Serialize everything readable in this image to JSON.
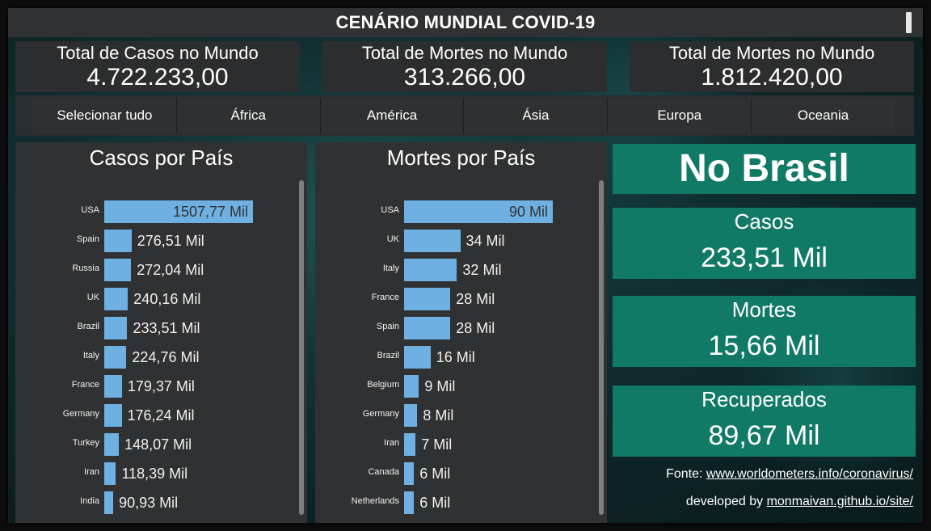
{
  "header": {
    "title": "CENÁRIO MUNDIAL COVID-19"
  },
  "kpis": [
    {
      "label": "Total de Casos no Mundo",
      "value": "4.722.233,00"
    },
    {
      "label": "Total de Mortes no Mundo",
      "value": "313.266,00"
    },
    {
      "label": "Total de Mortes no Mundo",
      "value": "1.812.420,00"
    }
  ],
  "slicer": {
    "items": [
      "Selecionar tudo",
      "África",
      "América",
      "Ásia",
      "Europa",
      "Oceania"
    ]
  },
  "chart_data": [
    {
      "type": "bar",
      "orientation": "horizontal",
      "title": "Casos por País",
      "categories": [
        "USA",
        "Spain",
        "Russia",
        "UK",
        "Brazil",
        "Italy",
        "France",
        "Germany",
        "Turkey",
        "Iran",
        "India"
      ],
      "values": [
        1507.77,
        276.51,
        272.04,
        240.16,
        233.51,
        224.76,
        179.37,
        176.24,
        148.07,
        118.39,
        90.93
      ],
      "value_labels": [
        "1507,77 Mil",
        "276,51 Mil",
        "272,04 Mil",
        "240,16 Mil",
        "233,51 Mil",
        "224,76 Mil",
        "179,37 Mil",
        "176,24 Mil",
        "148,07 Mil",
        "118,39 Mil",
        "90,93 Mil"
      ],
      "bar_color": "#6fb0e2"
    },
    {
      "type": "bar",
      "orientation": "horizontal",
      "title": "Mortes por País",
      "categories": [
        "USA",
        "UK",
        "Italy",
        "France",
        "Spain",
        "Brazil",
        "Belgium",
        "Germany",
        "Iran",
        "Canada",
        "Netherlands"
      ],
      "values": [
        90,
        34,
        32,
        28,
        28,
        16,
        9,
        8,
        7,
        6,
        6
      ],
      "value_labels": [
        "90 Mil",
        "34 Mil",
        "32 Mil",
        "28 Mil",
        "28 Mil",
        "16 Mil",
        "9 Mil",
        "8 Mil",
        "7 Mil",
        "6 Mil",
        "6 Mil"
      ],
      "bar_color": "#6fb0e2"
    }
  ],
  "brasil": {
    "title": "No Brasil",
    "casos_label": "Casos",
    "casos_value": "233,51 Mil",
    "mortes_label": "Mortes",
    "mortes_value": "15,66 Mil",
    "recuperados_label": "Recuperados",
    "recuperados_value": "89,67 Mil"
  },
  "footer": {
    "fonte_prefix": "Fonte: ",
    "fonte_link": "www.worldometers.info/coronavirus/",
    "dev_prefix": "developed by ",
    "dev_link": "monmaivan.github.io/site/"
  },
  "colors": {
    "tile": "#117a67",
    "bar": "#6fb0e2",
    "panel": "#2f3133"
  }
}
